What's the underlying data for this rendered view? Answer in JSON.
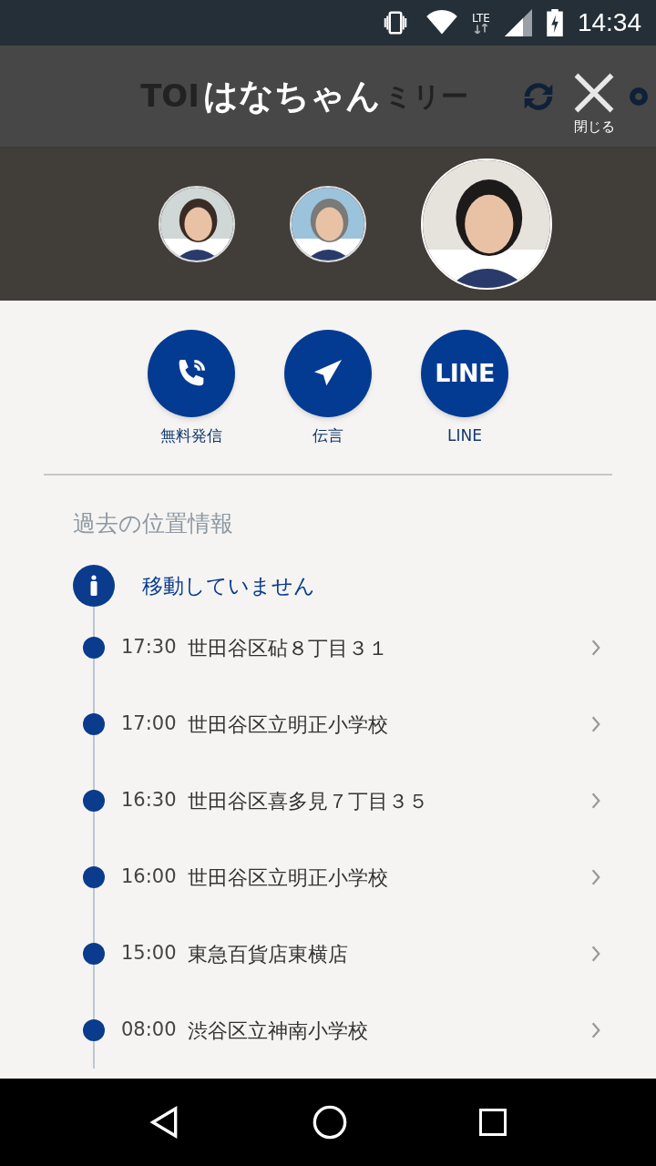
{
  "status_bar": {
    "network": "LTE",
    "time": "14:34"
  },
  "header": {
    "behind_left": "TOI",
    "behind_right": "ミリー",
    "title": "はなちゃん",
    "close_label": "閉じる"
  },
  "avatars": [
    {
      "selected": false
    },
    {
      "selected": false
    },
    {
      "selected": true
    }
  ],
  "actions": [
    {
      "kind": "phone",
      "label": "無料発信"
    },
    {
      "kind": "message",
      "label": "伝言"
    },
    {
      "kind": "line",
      "icon_text": "LINE",
      "label": "LINE"
    }
  ],
  "history": {
    "title": "過去の位置情報",
    "current": "移動していません",
    "entries": [
      {
        "time": "17:30",
        "place": "世田谷区砧８丁目３１"
      },
      {
        "time": "17:00",
        "place": "世田谷区立明正小学校"
      },
      {
        "time": "16:30",
        "place": "世田谷区喜多見７丁目３５"
      },
      {
        "time": "16:00",
        "place": "世田谷区立明正小学校"
      },
      {
        "time": "15:00",
        "place": "東急百貨店東横店"
      },
      {
        "time": "08:00",
        "place": "渋谷区立神南小学校"
      }
    ]
  }
}
